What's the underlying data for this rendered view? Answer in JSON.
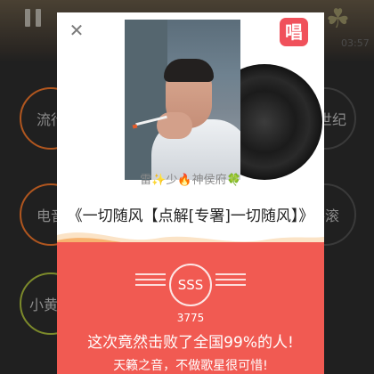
{
  "background": {
    "time": "03:57",
    "genres": [
      "流行",
      "新世纪",
      "电音",
      "摇滚",
      "小黄人"
    ]
  },
  "card": {
    "close_icon": "close-icon",
    "sing_badge": "唱",
    "singer": "雷✨少🔥神侯府🍀",
    "song_title": "《一切随风【点解[专署]一切随风】》",
    "rank": "SSS",
    "score": "3775",
    "beat_text": "这次竟然击败了全国99%的人!",
    "slogan": "天籁之音，不做歌星很可惜!",
    "colors": {
      "accent": "#f15a52",
      "badge": "#f0515b"
    }
  }
}
